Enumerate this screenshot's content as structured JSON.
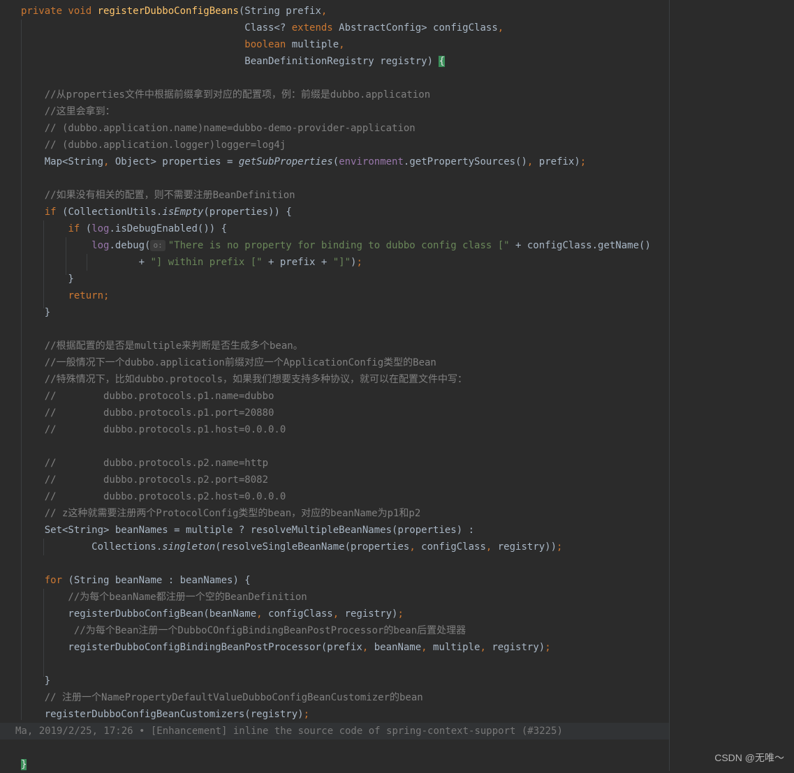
{
  "editor": {
    "lines": [
      [
        {
          "t": "private void ",
          "c": "kw"
        },
        {
          "t": "registerDubboConfigBeans",
          "c": "fn"
        },
        {
          "t": "(String prefix",
          "c": ""
        },
        {
          "t": ",",
          "c": "kw"
        }
      ],
      [
        {
          "t": "                                      Class<? ",
          "c": ""
        },
        {
          "t": "extends ",
          "c": "kw"
        },
        {
          "t": "AbstractConfig> configClass",
          "c": ""
        },
        {
          "t": ",",
          "c": "kw"
        }
      ],
      [
        {
          "t": "                                      ",
          "c": ""
        },
        {
          "t": "boolean ",
          "c": "kw"
        },
        {
          "t": "multiple",
          "c": ""
        },
        {
          "t": ",",
          "c": "kw"
        }
      ],
      [
        {
          "t": "                                      BeanDefinitionRegistry registry) ",
          "c": ""
        },
        {
          "t": "{",
          "c": "brace-hl"
        }
      ],
      [],
      [
        {
          "t": "    //从properties文件中根据前缀拿到对应的配置项，例：前缀是dubbo.application",
          "c": "cm"
        }
      ],
      [
        {
          "t": "    //这里会拿到：",
          "c": "cm"
        }
      ],
      [
        {
          "t": "    // (dubbo.application.name)name=dubbo-demo-provider-application",
          "c": "cm"
        }
      ],
      [
        {
          "t": "    // (dubbo.application.logger)logger=log4j",
          "c": "cm"
        }
      ],
      [
        {
          "t": "    Map<String",
          "c": ""
        },
        {
          "t": ", ",
          "c": "kw"
        },
        {
          "t": "Object> properties = ",
          "c": ""
        },
        {
          "t": "getSubProperties",
          "c": "it"
        },
        {
          "t": "(",
          "c": ""
        },
        {
          "t": "environment",
          "c": "fld"
        },
        {
          "t": ".getPropertySources()",
          "c": ""
        },
        {
          "t": ", ",
          "c": "kw"
        },
        {
          "t": "prefix)",
          "c": ""
        },
        {
          "t": ";",
          "c": "kw"
        }
      ],
      [],
      [
        {
          "t": "    //如果没有相关的配置，则不需要注册BeanDefinition",
          "c": "cm"
        }
      ],
      [
        {
          "t": "    ",
          "c": ""
        },
        {
          "t": "if ",
          "c": "kw"
        },
        {
          "t": "(CollectionUtils.",
          "c": ""
        },
        {
          "t": "isEmpty",
          "c": "it"
        },
        {
          "t": "(properties)) {",
          "c": ""
        }
      ],
      [
        {
          "t": "        ",
          "c": ""
        },
        {
          "t": "if ",
          "c": "kw"
        },
        {
          "t": "(",
          "c": ""
        },
        {
          "t": "log",
          "c": "fld"
        },
        {
          "t": ".isDebugEnabled()) {",
          "c": ""
        }
      ],
      [
        {
          "t": "            ",
          "c": ""
        },
        {
          "t": "log",
          "c": "fld"
        },
        {
          "t": ".debug(",
          "c": ""
        },
        {
          "t": "o:",
          "c": "hint"
        },
        {
          "t": "\"There is no property for binding to dubbo config class [\"",
          "c": "st"
        },
        {
          "t": " + configClass.getName()",
          "c": ""
        }
      ],
      [
        {
          "t": "                    + ",
          "c": ""
        },
        {
          "t": "\"] within prefix [\"",
          "c": "st"
        },
        {
          "t": " + prefix + ",
          "c": ""
        },
        {
          "t": "\"]\"",
          "c": "st"
        },
        {
          "t": ")",
          "c": ""
        },
        {
          "t": ";",
          "c": "kw"
        }
      ],
      [
        {
          "t": "        }",
          "c": ""
        }
      ],
      [
        {
          "t": "        ",
          "c": ""
        },
        {
          "t": "return;",
          "c": "kw"
        }
      ],
      [
        {
          "t": "    }",
          "c": ""
        }
      ],
      [],
      [
        {
          "t": "    //根据配置的是否是multiple来判断是否生成多个bean。",
          "c": "cm"
        }
      ],
      [
        {
          "t": "    //一般情况下一个dubbo.application前缀对应一个ApplicationConfig类型的Bean",
          "c": "cm"
        }
      ],
      [
        {
          "t": "    //特殊情况下，比如dubbo.protocols，如果我们想要支持多种协议，就可以在配置文件中写：",
          "c": "cm"
        }
      ],
      [
        {
          "t": "    //        dubbo.protocols.p1.name=dubbo",
          "c": "cm"
        }
      ],
      [
        {
          "t": "    //        dubbo.protocols.p1.port=20880",
          "c": "cm"
        }
      ],
      [
        {
          "t": "    //        dubbo.protocols.p1.host=0.0.0.0",
          "c": "cm"
        }
      ],
      [],
      [
        {
          "t": "    //        dubbo.protocols.p2.name=http",
          "c": "cm"
        }
      ],
      [
        {
          "t": "    //        dubbo.protocols.p2.port=8082",
          "c": "cm"
        }
      ],
      [
        {
          "t": "    //        dubbo.protocols.p2.host=0.0.0.0",
          "c": "cm"
        }
      ],
      [
        {
          "t": "    // z这种就需要注册两个ProtocolConfig类型的bean，对应的beanName为p1和p2",
          "c": "cm"
        }
      ],
      [
        {
          "t": "    Set<String> beanNames = multiple ? resolveMultipleBeanNames(properties) :",
          "c": ""
        }
      ],
      [
        {
          "t": "            Collections.",
          "c": ""
        },
        {
          "t": "singleton",
          "c": "it"
        },
        {
          "t": "(resolveSingleBeanName(properties",
          "c": ""
        },
        {
          "t": ", ",
          "c": "kw"
        },
        {
          "t": "configClass",
          "c": ""
        },
        {
          "t": ", ",
          "c": "kw"
        },
        {
          "t": "registry))",
          "c": ""
        },
        {
          "t": ";",
          "c": "kw"
        }
      ],
      [],
      [
        {
          "t": "    ",
          "c": ""
        },
        {
          "t": "for ",
          "c": "kw"
        },
        {
          "t": "(String beanName : beanNames) {",
          "c": ""
        }
      ],
      [
        {
          "t": "        //为每个beanName都注册一个空的BeanDefinition",
          "c": "cm"
        }
      ],
      [
        {
          "t": "        registerDubboConfigBean(beanName",
          "c": ""
        },
        {
          "t": ", ",
          "c": "kw"
        },
        {
          "t": "configClass",
          "c": ""
        },
        {
          "t": ", ",
          "c": "kw"
        },
        {
          "t": "registry)",
          "c": ""
        },
        {
          "t": ";",
          "c": "kw"
        }
      ],
      [
        {
          "t": "         //为每个Bean注册一个DubboCOnfigBindingBeanPostProcessor的bean后置处理器",
          "c": "cm"
        }
      ],
      [
        {
          "t": "        registerDubboConfigBindingBeanPostProcessor(prefix",
          "c": ""
        },
        {
          "t": ", ",
          "c": "kw"
        },
        {
          "t": "beanName",
          "c": ""
        },
        {
          "t": ", ",
          "c": "kw"
        },
        {
          "t": "multiple",
          "c": ""
        },
        {
          "t": ", ",
          "c": "kw"
        },
        {
          "t": "registry)",
          "c": ""
        },
        {
          "t": ";",
          "c": "kw"
        }
      ],
      [],
      [
        {
          "t": "    }",
          "c": ""
        }
      ],
      [
        {
          "t": "    // 注册一个NamePropertyDefaultValueDubboConfigBeanCustomizer的bean",
          "c": "cm"
        }
      ],
      [
        {
          "t": "    registerDubboConfigBeanCustomizers(registry)",
          "c": ""
        },
        {
          "t": ";",
          "c": "kw"
        }
      ],
      [],
      [
        {
          "t": "}",
          "c": "brace-hl"
        }
      ]
    ],
    "blame": "Ma, 2019/2/25, 17:26 • [Enhancement] inline the source code of spring-context-support (#3225)",
    "watermark": "CSDN @无唯～"
  }
}
